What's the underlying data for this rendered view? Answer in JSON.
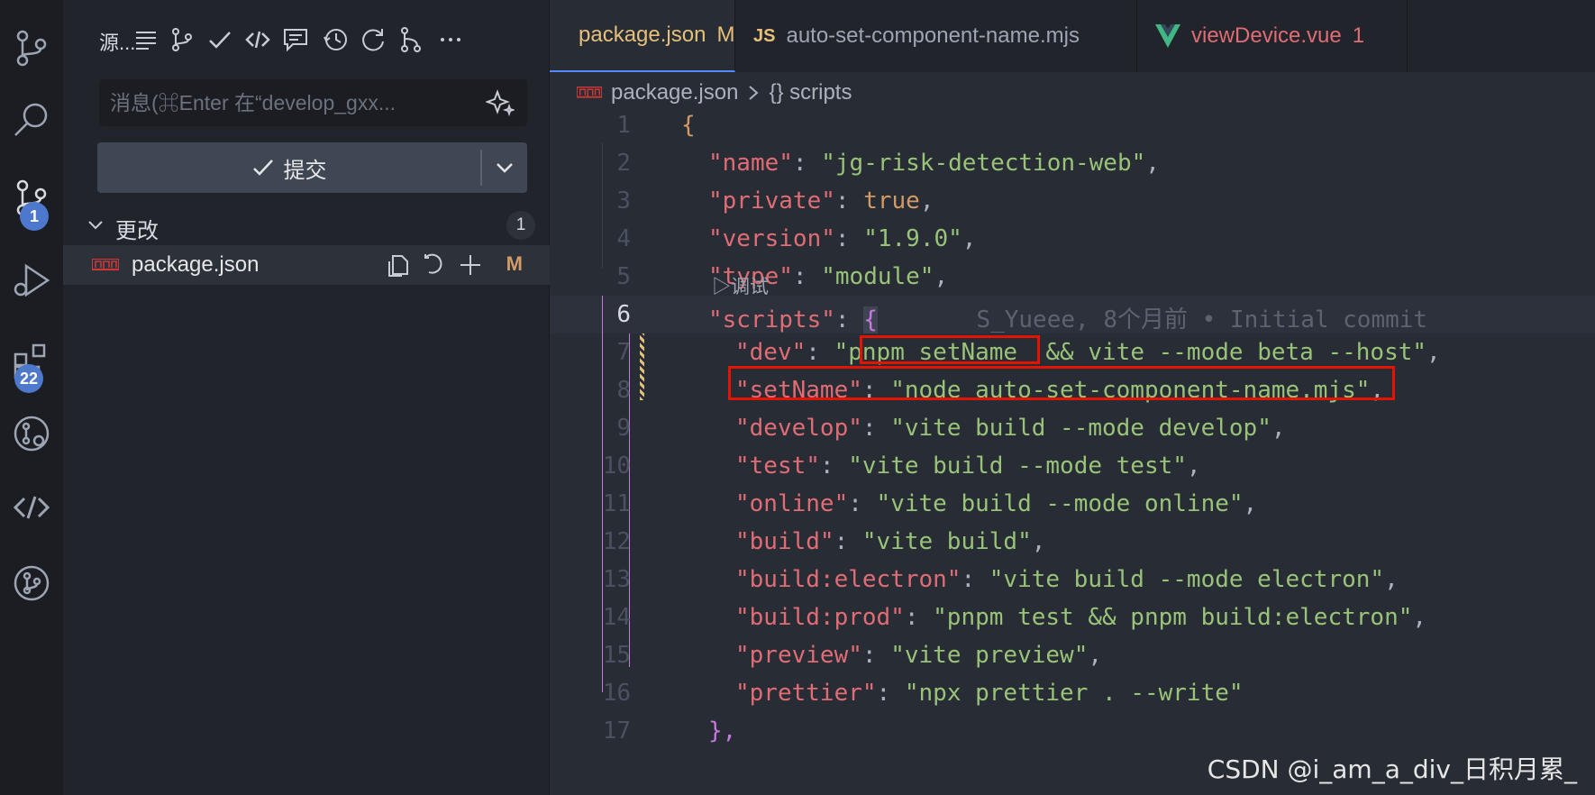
{
  "activity_bar": {
    "items": [
      {
        "name": "source-control-icon"
      },
      {
        "name": "search-icon"
      },
      {
        "name": "source-control-active-icon",
        "badge": "1"
      },
      {
        "name": "run-debug-icon"
      },
      {
        "name": "extensions-icon",
        "badge": "22"
      },
      {
        "name": "git-graph-icon"
      },
      {
        "name": "remote-icon"
      },
      {
        "name": "branch-icon"
      }
    ]
  },
  "sidebar": {
    "title": "源...",
    "message_placeholder": "消息(⌘Enter 在“develop_gxx...",
    "commit_label": "提交",
    "changes_label": "更改",
    "changes_count": "1",
    "file": {
      "name": "package.json",
      "status": "M"
    }
  },
  "tabs": [
    {
      "label": "package.json",
      "status": "M",
      "active": true,
      "color": "#e5c07b"
    },
    {
      "label": "auto-set-component-name.mjs",
      "status": "",
      "active": false,
      "color": "#9da5b4"
    },
    {
      "label": "viewDevice.vue",
      "status": "1",
      "active": false,
      "color": "#e06c75"
    }
  ],
  "breadcrumb": {
    "file": "package.json",
    "section": "{} scripts"
  },
  "codelens": "▷调试",
  "blame": "S_Yueee, 8个月前 • Initial commit",
  "code_lines": [
    {
      "n": "1",
      "text": "{"
    },
    {
      "n": "2",
      "key": "\"name\"",
      "val": "\"jg-risk-detection-web\"",
      "tail": ","
    },
    {
      "n": "3",
      "key": "\"private\"",
      "val": "true",
      "tail": ","
    },
    {
      "n": "4",
      "key": "\"version\"",
      "val": "\"1.9.0\"",
      "tail": ","
    },
    {
      "n": "5",
      "key": "\"type\"",
      "val": "\"module\"",
      "tail": ","
    },
    {
      "n": "6",
      "key": "\"scripts\"",
      "val": "{",
      "tail": ""
    },
    {
      "n": "7",
      "key": "\"dev\"",
      "val": "\"pnpm setName  && vite --mode beta --host\"",
      "tail": ","
    },
    {
      "n": "8",
      "key": "\"setName\"",
      "val": "\"node auto-set-component-name.mjs\"",
      "tail": ","
    },
    {
      "n": "9",
      "key": "\"develop\"",
      "val": "\"vite build --mode develop\"",
      "tail": ","
    },
    {
      "n": "10",
      "key": "\"test\"",
      "val": "\"vite build --mode test\"",
      "tail": ","
    },
    {
      "n": "11",
      "key": "\"online\"",
      "val": "\"vite build --mode online\"",
      "tail": ","
    },
    {
      "n": "12",
      "key": "\"build\"",
      "val": "\"vite build\"",
      "tail": ","
    },
    {
      "n": "13",
      "key": "\"build:electron\"",
      "val": "\"vite build --mode electron\"",
      "tail": ","
    },
    {
      "n": "14",
      "key": "\"build:prod\"",
      "val": "\"pnpm test && pnpm build:electron\"",
      "tail": ","
    },
    {
      "n": "15",
      "key": "\"preview\"",
      "val": "\"vite preview\"",
      "tail": ","
    },
    {
      "n": "16",
      "key": "\"prettier\"",
      "val": "\"npx prettier . --write\"",
      "tail": ""
    },
    {
      "n": "17",
      "text": "},"
    }
  ],
  "watermark": "CSDN @i_am_a_div_日积月累_"
}
